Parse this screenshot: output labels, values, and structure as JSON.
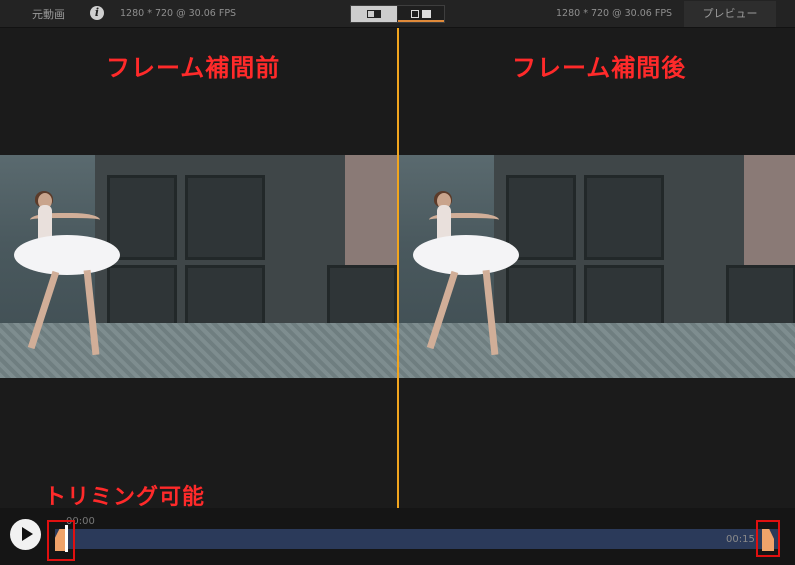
{
  "topbar": {
    "left_label": "元動画",
    "info_icon": "info-icon",
    "resolution_left": "1280 * 720 @ 30.06 FPS",
    "resolution_right": "1280 * 720 @ 30.06 FPS",
    "preview_tab": "プレビュー",
    "view_toggle": {
      "options": [
        "split-view-icon",
        "side-by-side-icon"
      ],
      "selected": 1
    }
  },
  "annotations": {
    "left_heading": "フレーム補間前",
    "right_heading": "フレーム補間後",
    "trim_label": "トリミング可能"
  },
  "timeline": {
    "start_time": "00:00",
    "end_time": "00:15",
    "play_icon": "play-icon"
  },
  "colors": {
    "accent": "#f2a51e",
    "annotation": "#ff2a2a",
    "track": "#2b3a5a",
    "handle": "#f0a36a"
  }
}
